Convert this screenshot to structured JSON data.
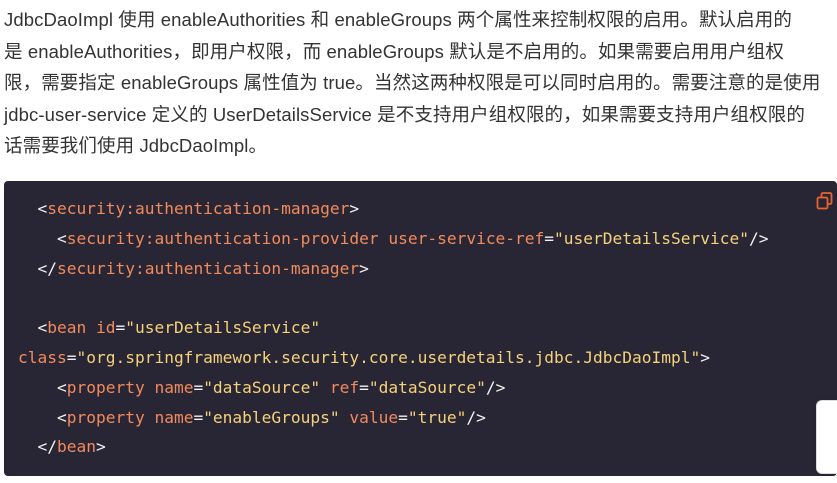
{
  "paragraph": {
    "lines": [
      "JdbcDaoImpl 使用 enableAuthorities 和 enableGroups 两个属性来控制权限的启用。默认启用的",
      "是 enableAuthorities，即用户权限，而 enableGroups 默认是不启用的。如果需要启用用户组权",
      "限，需要指定 enableGroups 属性值为 true。当然这两种权限是可以同时启用的。需要注意的是使用",
      "jdbc-user-service 定义的 UserDetailsService 是不支持用户组权限的，如果需要支持用户组权限的",
      "话需要我们使用 JdbcDaoImpl。"
    ]
  },
  "code_block": {
    "copy_icon": "copy-icon",
    "colors": {
      "background": "#282634",
      "tag": "#f28a5c",
      "string": "#f5d27a",
      "punctuation": "#f2f2f2",
      "copy_icon": "#e8632e"
    },
    "lines": [
      {
        "indent": "  ",
        "tokens": [
          {
            "t": "punc",
            "v": "<"
          },
          {
            "t": "tag",
            "v": "security:authentication-manager"
          },
          {
            "t": "punc",
            "v": ">"
          }
        ]
      },
      {
        "indent": "    ",
        "tokens": [
          {
            "t": "punc",
            "v": "<"
          },
          {
            "t": "tag",
            "v": "security:authentication-provider"
          },
          {
            "t": "punc",
            "v": " "
          },
          {
            "t": "attr",
            "v": "user-service-ref"
          },
          {
            "t": "punc",
            "v": "="
          },
          {
            "t": "str",
            "v": "\"userDetailsService\""
          },
          {
            "t": "punc",
            "v": "/>"
          }
        ]
      },
      {
        "indent": "  ",
        "tokens": [
          {
            "t": "punc",
            "v": "</"
          },
          {
            "t": "tag",
            "v": "security:authentication-manager"
          },
          {
            "t": "punc",
            "v": ">"
          }
        ]
      },
      {
        "indent": "",
        "tokens": []
      },
      {
        "indent": "  ",
        "tokens": [
          {
            "t": "punc",
            "v": "<"
          },
          {
            "t": "tag",
            "v": "bean"
          },
          {
            "t": "punc",
            "v": " "
          },
          {
            "t": "attr",
            "v": "id"
          },
          {
            "t": "punc",
            "v": "="
          },
          {
            "t": "str",
            "v": "\"userDetailsService\""
          }
        ]
      },
      {
        "indent": "",
        "tokens": [
          {
            "t": "attr",
            "v": "class"
          },
          {
            "t": "punc",
            "v": "="
          },
          {
            "t": "str",
            "v": "\"org.springframework.security.core.userdetails.jdbc.JdbcDaoImpl\""
          },
          {
            "t": "punc",
            "v": ">"
          }
        ]
      },
      {
        "indent": "    ",
        "tokens": [
          {
            "t": "punc",
            "v": "<"
          },
          {
            "t": "tag",
            "v": "property"
          },
          {
            "t": "punc",
            "v": " "
          },
          {
            "t": "attr",
            "v": "name"
          },
          {
            "t": "punc",
            "v": "="
          },
          {
            "t": "str",
            "v": "\"dataSource\""
          },
          {
            "t": "punc",
            "v": " "
          },
          {
            "t": "attr",
            "v": "ref"
          },
          {
            "t": "punc",
            "v": "="
          },
          {
            "t": "str",
            "v": "\"dataSource\""
          },
          {
            "t": "punc",
            "v": "/>"
          }
        ]
      },
      {
        "indent": "    ",
        "tokens": [
          {
            "t": "punc",
            "v": "<"
          },
          {
            "t": "tag",
            "v": "property"
          },
          {
            "t": "punc",
            "v": " "
          },
          {
            "t": "attr",
            "v": "name"
          },
          {
            "t": "punc",
            "v": "="
          },
          {
            "t": "str",
            "v": "\"enableGroups\""
          },
          {
            "t": "punc",
            "v": " "
          },
          {
            "t": "attr",
            "v": "value"
          },
          {
            "t": "punc",
            "v": "="
          },
          {
            "t": "str",
            "v": "\"true\""
          },
          {
            "t": "punc",
            "v": "/>"
          }
        ]
      },
      {
        "indent": "  ",
        "tokens": [
          {
            "t": "punc",
            "v": "</"
          },
          {
            "t": "tag",
            "v": "bean"
          },
          {
            "t": "punc",
            "v": ">"
          }
        ]
      }
    ]
  }
}
